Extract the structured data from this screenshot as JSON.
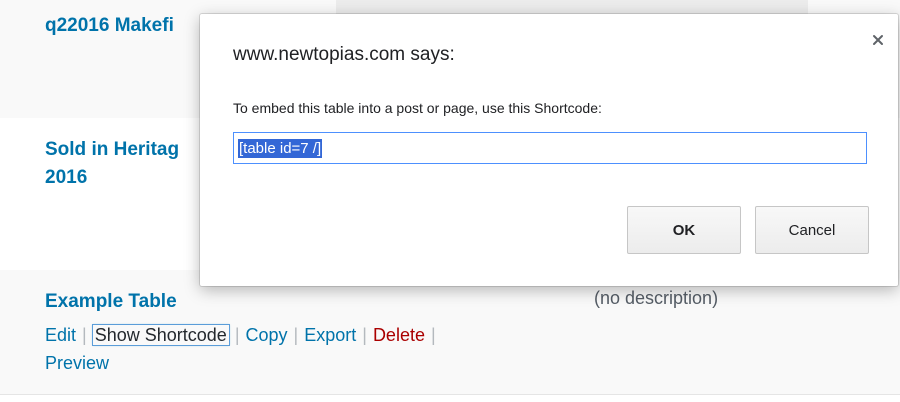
{
  "background_rows": {
    "row1_title": "q22016 Makefi",
    "row2_title_line1": "Sold in Heritag",
    "row2_title_line2": "2016",
    "row3_title": "Example Table",
    "row3_description": "(no description)"
  },
  "row_actions": {
    "edit": "Edit",
    "show_shortcode": "Show Shortcode",
    "copy": "Copy",
    "export": "Export",
    "delete": "Delete",
    "preview": "Preview",
    "separator": "|"
  },
  "dialog": {
    "host_text": "www.newtopias.com says:",
    "message": "To embed this table into a post or page, use this Shortcode:",
    "input_value": "[table id=7 /]",
    "ok_label": "OK",
    "cancel_label": "Cancel",
    "close_icon": "close-icon"
  },
  "colors": {
    "link": "#0073aa",
    "delete": "#aa0000",
    "selection": "#3367d6",
    "input_focus_border": "#4d90fe"
  }
}
